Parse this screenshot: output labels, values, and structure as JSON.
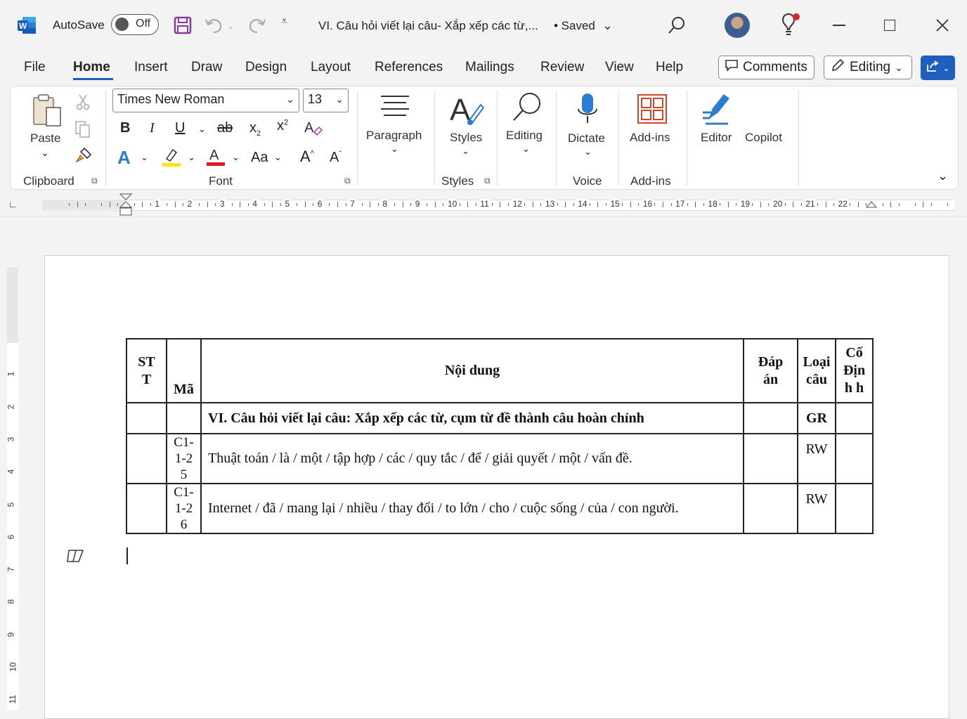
{
  "titlebar": {
    "autosave_label": "AutoSave",
    "autosave_state": "Off",
    "doc_title": "VI. Câu hỏi viết lại câu- Xắp xếp các từ,...",
    "save_status": "• Saved"
  },
  "menu": {
    "tabs": [
      "File",
      "Home",
      "Insert",
      "Draw",
      "Design",
      "Layout",
      "References",
      "Mailings",
      "Review",
      "View",
      "Help"
    ],
    "active_tab": "Home",
    "comments_label": "Comments",
    "editing_label": "Editing"
  },
  "ribbon": {
    "clipboard": {
      "paste_label": "Paste",
      "group_label": "Clipboard"
    },
    "font": {
      "font_name": "Times New Roman",
      "font_size": "13",
      "group_label": "Font"
    },
    "paragraph_label": "Paragraph",
    "styles": {
      "button_label": "Styles",
      "group_label": "Styles"
    },
    "editing_label": "Editing",
    "voice": {
      "button_label": "Dictate",
      "group_label": "Voice"
    },
    "addins": {
      "button_label": "Add-ins",
      "group_label": "Add-ins"
    },
    "editor_label": "Editor",
    "copilot_label": "Copilot"
  },
  "ruler": {
    "h_numbers": [
      "1",
      "2",
      "3",
      "4",
      "5",
      "6",
      "7",
      "8",
      "9",
      "10",
      "11",
      "12",
      "13",
      "14",
      "15",
      "16",
      "17",
      "18",
      "19",
      "20",
      "21",
      "22"
    ],
    "v_numbers": [
      "1",
      "2",
      "3",
      "4",
      "5",
      "6",
      "7",
      "8",
      "9",
      "10",
      "11"
    ]
  },
  "table": {
    "headers": {
      "stt": "ST T",
      "ma": "Mã",
      "content": "Nội dung",
      "answer": "Đáp án",
      "type": "Loại câu",
      "fixed": "Cố Định h"
    },
    "section_row": {
      "content": "VI. Câu hỏi viết lại câu: Xắp xếp các từ, cụm từ đề thành câu hoàn chỉnh",
      "type": "GR"
    },
    "rows": [
      {
        "code": "C1-1-25",
        "content": "Thuật toán / là / một / tập hợp / các / quy tắc / để / giải quyết / một / vấn đề.",
        "type": "RW"
      },
      {
        "code": "C1-1-26",
        "content": "Internet / đã / mang lại / nhiều / thay đổi / to lớn / cho / cuộc sống / của / con người.",
        "type": "RW"
      }
    ]
  },
  "colors": {
    "accent": "#1f5fbf",
    "word_blue": "#185abd",
    "save_purple": "#8a3a9a",
    "addins_orange": "#d24726"
  }
}
